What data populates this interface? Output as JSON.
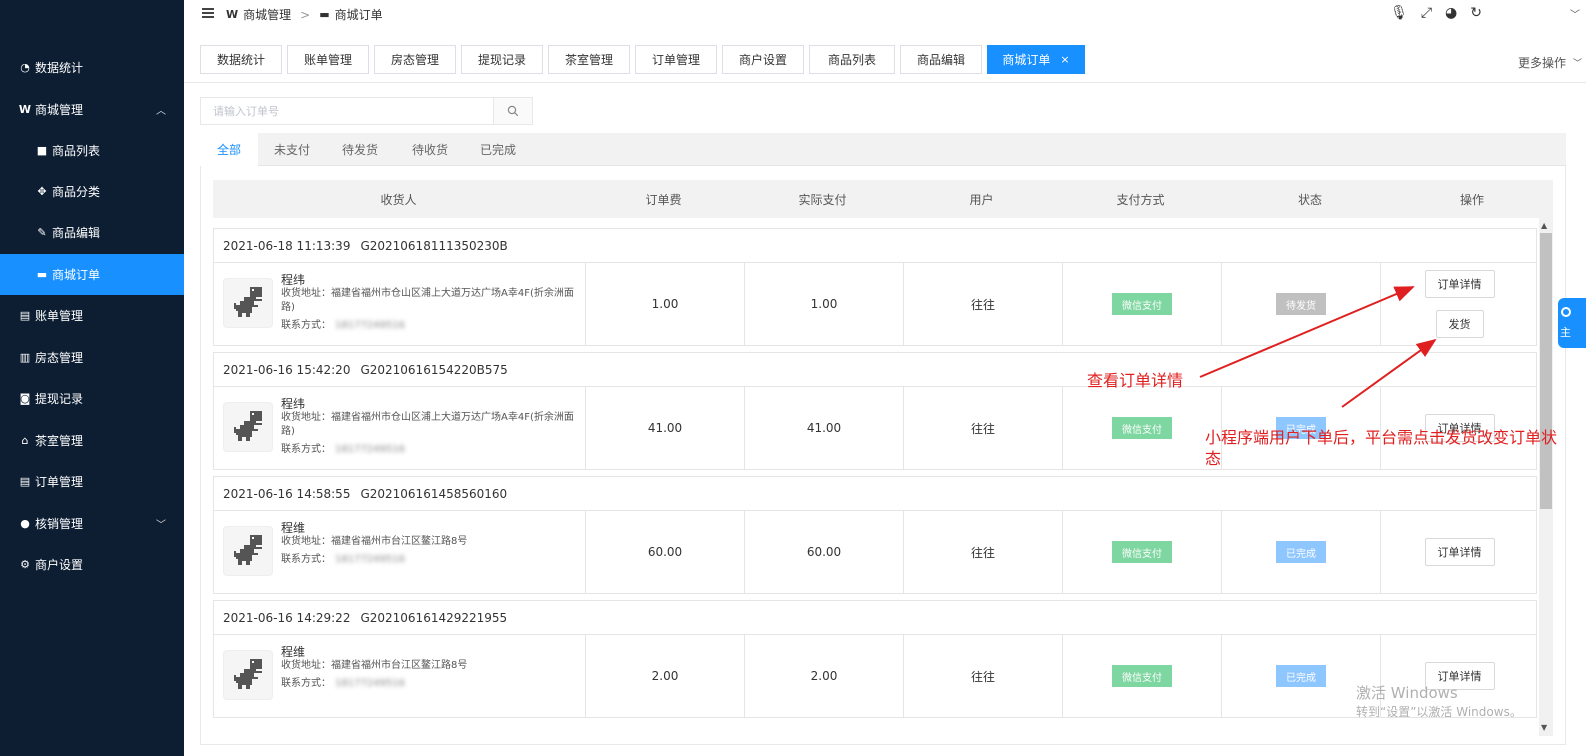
{
  "sidebar": {
    "items": [
      {
        "label": "数据统计",
        "icon": "dashboard-icon",
        "glyph": "◔"
      },
      {
        "label": "商城管理",
        "icon": "shop-icon",
        "glyph": "W"
      },
      {
        "label": "商品列表",
        "icon": "lock-icon",
        "glyph": "■"
      },
      {
        "label": "商品分类",
        "icon": "move-icon",
        "glyph": "✥"
      },
      {
        "label": "商品编辑",
        "icon": "edit-icon",
        "glyph": "✎"
      },
      {
        "label": "商城订单",
        "icon": "order-card-icon",
        "glyph": "▬"
      },
      {
        "label": "账单管理",
        "icon": "id-card-icon",
        "glyph": "▤"
      },
      {
        "label": "房态管理",
        "icon": "building-icon",
        "glyph": "▥"
      },
      {
        "label": "提现记录",
        "icon": "money-icon",
        "glyph": "◙"
      },
      {
        "label": "茶室管理",
        "icon": "home-icon",
        "glyph": "⌂"
      },
      {
        "label": "订单管理",
        "icon": "list-icon",
        "glyph": "▤"
      },
      {
        "label": "核销管理",
        "icon": "user-icon",
        "glyph": "●"
      },
      {
        "label": "商户设置",
        "icon": "gear-icon",
        "glyph": "⚙"
      }
    ]
  },
  "header": {
    "breadcrumb": [
      "商城管理",
      "商城订单"
    ],
    "separator": ">"
  },
  "tabs": [
    {
      "label": "数据统计"
    },
    {
      "label": "账单管理"
    },
    {
      "label": "房态管理"
    },
    {
      "label": "提现记录"
    },
    {
      "label": "茶室管理"
    },
    {
      "label": "订单管理"
    },
    {
      "label": "商户设置"
    },
    {
      "label": "商品列表"
    },
    {
      "label": "商品编辑"
    },
    {
      "label": "商城订单"
    }
  ],
  "tab_close": "×",
  "more_ops": "更多操作",
  "search": {
    "placeholder": "请输入订单号"
  },
  "status_tabs": [
    "全部",
    "未支付",
    "待发货",
    "待收货",
    "已完成"
  ],
  "columns": [
    "收货人",
    "订单费",
    "实际支付",
    "用户",
    "支付方式",
    "状态",
    "操作"
  ],
  "receiver_labels": {
    "address": "收货地址：",
    "phone": "联系方式："
  },
  "orders": [
    {
      "datetime": "2021-06-18 11:13:39",
      "order_no": "G20210618111350230B",
      "name": "程纬",
      "address": "福建省福州市仓山区浦上大道万达广场A幸4F(折余洲面路)",
      "phone": "18177249516",
      "fee": "1.00",
      "paid": "1.00",
      "user": "往往",
      "pay_method": "微信支付",
      "status": "待发货",
      "actions": [
        "订单详情",
        "发货"
      ]
    },
    {
      "datetime": "2021-06-16 15:42:20",
      "order_no": "G20210616154220B575",
      "name": "程纬",
      "address": "福建省福州市仓山区浦上大道万达广场A幸4F(折余洲面路)",
      "phone": "18177249516",
      "fee": "41.00",
      "paid": "41.00",
      "user": "往往",
      "pay_method": "微信支付",
      "status": "已完成",
      "actions": [
        "订单详情"
      ]
    },
    {
      "datetime": "2021-06-16 14:58:55",
      "order_no": "G202106161458560160",
      "name": "程维",
      "address": "福建省福州市台江区鳌江路8号",
      "phone": "18177249516",
      "fee": "60.00",
      "paid": "60.00",
      "user": "往往",
      "pay_method": "微信支付",
      "status": "已完成",
      "actions": [
        "订单详情"
      ]
    },
    {
      "datetime": "2021-06-16 14:29:22",
      "order_no": "G202106161429221955",
      "name": "程维",
      "address": "福建省福州市台江区鳌江路8号",
      "phone": "18177249516",
      "fee": "2.00",
      "paid": "2.00",
      "user": "往往",
      "pay_method": "微信支付",
      "status": "已完成",
      "actions": [
        "订单详情"
      ]
    }
  ],
  "annotations": {
    "view_details": "查看订单详情",
    "ship_note": "小程序端用户下单后，平台需点击发货改变订单状态"
  },
  "watermark": {
    "line1": "激活 Windows",
    "line2": "转到“设置”以激活 Windows。"
  },
  "float_tab": "主",
  "colors": {
    "sidebar_bg": "#0d1e33",
    "accent": "#1890ff",
    "annotation": "#e02020",
    "paid_badge": "#7ed6a0",
    "pending_badge": "#c0c0c0",
    "done_badge": "#8ec6ff"
  }
}
